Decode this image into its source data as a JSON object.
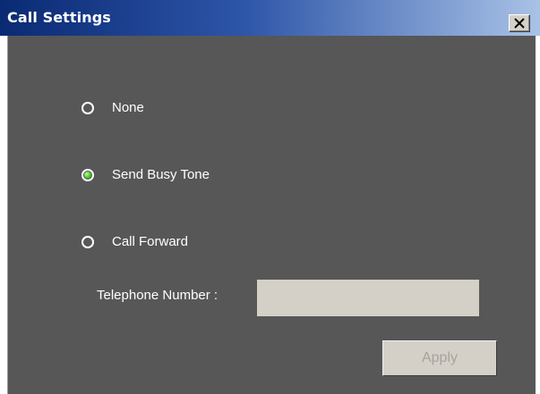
{
  "window": {
    "title": "Call Settings"
  },
  "options": [
    {
      "label": "None",
      "selected": false
    },
    {
      "label": "Send Busy Tone",
      "selected": true
    },
    {
      "label": "Call Forward",
      "selected": false
    }
  ],
  "telephone": {
    "label": "Telephone Number :",
    "value": "",
    "placeholder": ""
  },
  "apply": {
    "label": "Apply",
    "enabled": false
  },
  "icons": {
    "close": "close-icon"
  },
  "colors": {
    "title_bar_start": "#0a2a73",
    "title_bar_end": "#a9c2e6",
    "panel_background": "#575757",
    "selected_radio": "#46c81f"
  }
}
